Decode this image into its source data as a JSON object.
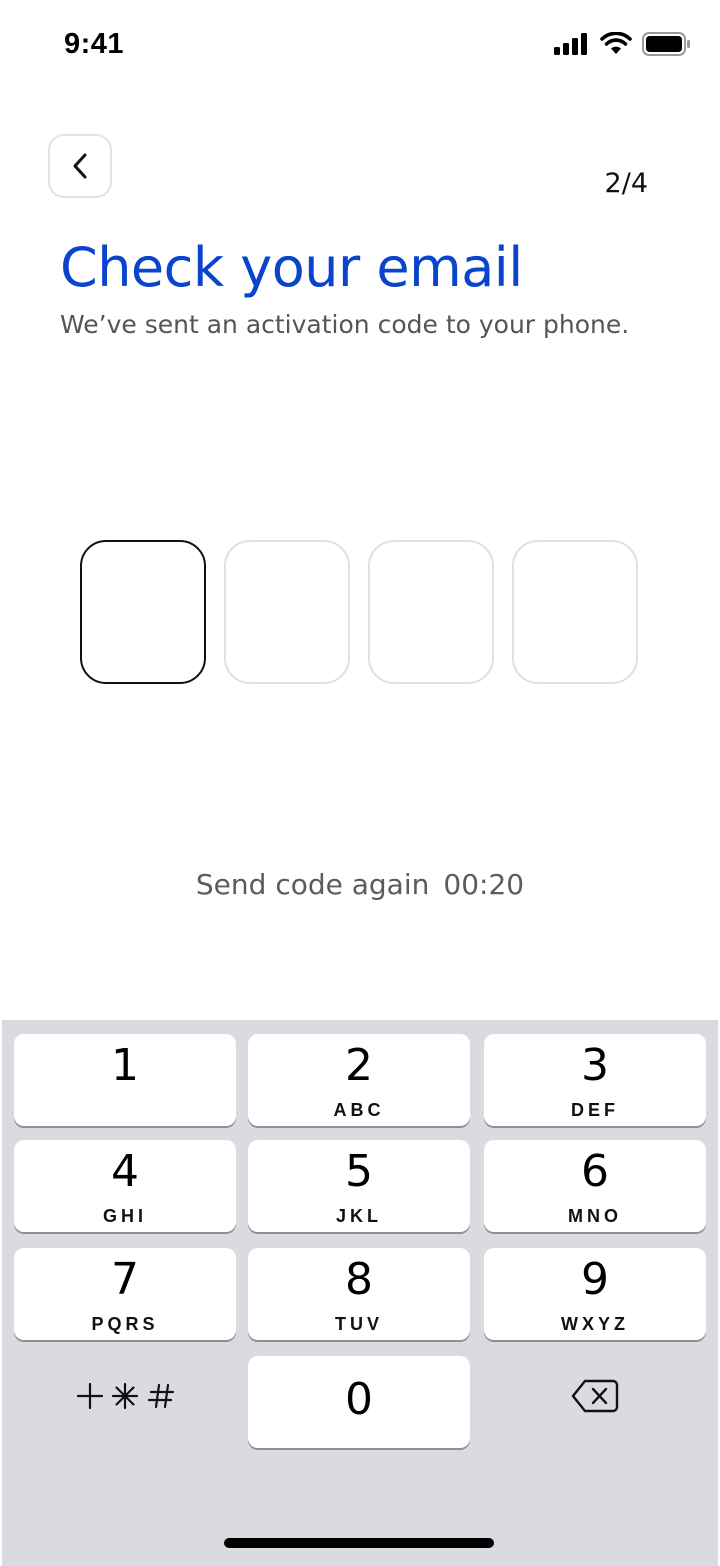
{
  "status_bar": {
    "time": "9:41"
  },
  "header": {
    "step": "2/4"
  },
  "title": "Check your email",
  "subtitle": "We’ve sent an activation code to your phone.",
  "code": {
    "length": 4,
    "active_index": 0
  },
  "resend": {
    "label": "Send code again",
    "timer": "00:20"
  },
  "keypad": {
    "keys": [
      {
        "num": "1",
        "letters": ""
      },
      {
        "num": "2",
        "letters": "ABC"
      },
      {
        "num": "3",
        "letters": "DEF"
      },
      {
        "num": "4",
        "letters": "GHI"
      },
      {
        "num": "5",
        "letters": "JKL"
      },
      {
        "num": "6",
        "letters": "MNO"
      },
      {
        "num": "7",
        "letters": "PQRS"
      },
      {
        "num": "8",
        "letters": "TUV"
      },
      {
        "num": "9",
        "letters": "WXYZ"
      }
    ],
    "zero": "0",
    "symbols_icon": "plus-star-hash-icon",
    "delete_icon": "backspace-icon"
  },
  "colors": {
    "accent": "#0a43cc",
    "keypad_bg": "#d9dbe0"
  }
}
